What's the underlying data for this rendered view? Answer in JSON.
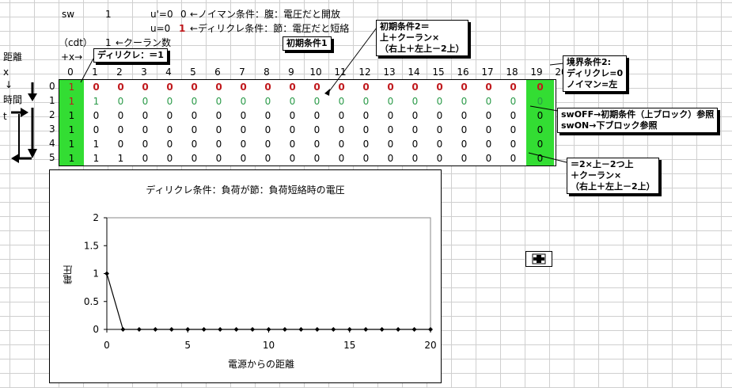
{
  "header": {
    "sw_label": "sw",
    "sw_value": "1",
    "neumann_cond": "u'=0",
    "neumann_value": "0",
    "neumann_desc": "←ノイマン条件：腹：電圧だと開放",
    "dirichlet_cond": "u=0",
    "dirichlet_value": "1",
    "dirichlet_desc": "←ディリクレ条件：節：電圧だと短絡",
    "cdt_label": "（cdt）",
    "courant_value": "1",
    "courant_desc": "←クーラン数",
    "x_label": "x",
    "distance_label": "距離",
    "x_arrow": "+x→",
    "time_arrow": "↓",
    "time_label": "時間",
    "t_label": "t"
  },
  "callouts": {
    "dirichlet": "ディリクレ：＝1",
    "initial1": "初期条件1",
    "initial2_line1": "初期条件2＝",
    "initial2_line2": "上＋クーラン×",
    "initial2_line3": "（右上＋左上－2上）",
    "boundary_line1": "境界条件2:",
    "boundary_line2": "ディリクレ=0",
    "boundary_line3": "ノイマン=左",
    "sw_line1": "swOFF→初期条件（上ブロック）参照",
    "sw_line2": "swON→下ブロック参照",
    "formula_line1": "＝2×上－2つ上",
    "formula_line2": "＋クーラン×",
    "formula_line3": "（右上＋左上－2上）"
  },
  "grid": {
    "columns": [
      "0",
      "1",
      "2",
      "3",
      "4",
      "5",
      "6",
      "7",
      "8",
      "9",
      "10",
      "11",
      "12",
      "13",
      "14",
      "15",
      "16",
      "17",
      "18",
      "19",
      "20"
    ],
    "rows": [
      {
        "label": "0",
        "style": "red",
        "values": [
          "1",
          "0",
          "0",
          "0",
          "0",
          "0",
          "0",
          "0",
          "0",
          "0",
          "0",
          "0",
          "0",
          "0",
          "0",
          "0",
          "0",
          "0",
          "0",
          "0",
          "0"
        ]
      },
      {
        "label": "1",
        "style": "green",
        "values": [
          "1",
          "1",
          "0",
          "0",
          "0",
          "0",
          "0",
          "0",
          "0",
          "0",
          "0",
          "0",
          "0",
          "0",
          "0",
          "0",
          "0",
          "0",
          "0",
          "0",
          "0"
        ]
      },
      {
        "label": "2",
        "style": "plain",
        "values": [
          "1",
          "0",
          "0",
          "0",
          "0",
          "0",
          "0",
          "0",
          "0",
          "0",
          "0",
          "0",
          "0",
          "0",
          "0",
          "0",
          "0",
          "0",
          "0",
          "0",
          "0"
        ]
      },
      {
        "label": "3",
        "style": "plain",
        "values": [
          "1",
          "0",
          "0",
          "0",
          "0",
          "0",
          "0",
          "0",
          "0",
          "0",
          "0",
          "0",
          "0",
          "0",
          "0",
          "0",
          "0",
          "0",
          "0",
          "0",
          "0"
        ]
      },
      {
        "label": "4",
        "style": "plain",
        "values": [
          "1",
          "1",
          "0",
          "0",
          "0",
          "0",
          "0",
          "0",
          "0",
          "0",
          "0",
          "0",
          "0",
          "0",
          "0",
          "0",
          "0",
          "0",
          "0",
          "0",
          "0"
        ]
      },
      {
        "label": "5",
        "style": "plain",
        "values": [
          "1",
          "1",
          "1",
          "0",
          "0",
          "0",
          "0",
          "0",
          "0",
          "0",
          "0",
          "0",
          "0",
          "0",
          "0",
          "0",
          "0",
          "0",
          "0",
          "0",
          "0"
        ]
      }
    ]
  },
  "chart_data": {
    "type": "line",
    "title": "ディリクレ条件：負荷が節：負荷短絡時の電圧",
    "xlabel": "電源からの距離",
    "ylabel": "電圧",
    "x": [
      0,
      1,
      2,
      3,
      4,
      5,
      6,
      7,
      8,
      9,
      10,
      11,
      12,
      13,
      14,
      15,
      16,
      17,
      18,
      19,
      20
    ],
    "values": [
      1,
      0,
      0,
      0,
      0,
      0,
      0,
      0,
      0,
      0,
      0,
      0,
      0,
      0,
      0,
      0,
      0,
      0,
      0,
      0,
      0
    ],
    "xlim": [
      0,
      20
    ],
    "ylim": [
      0,
      2
    ],
    "xticks": [
      "0",
      "5",
      "10",
      "15",
      "20"
    ],
    "yticks": [
      "0",
      "0.5",
      "1",
      "1.5",
      "2"
    ],
    "grid": false,
    "legend": "none"
  }
}
